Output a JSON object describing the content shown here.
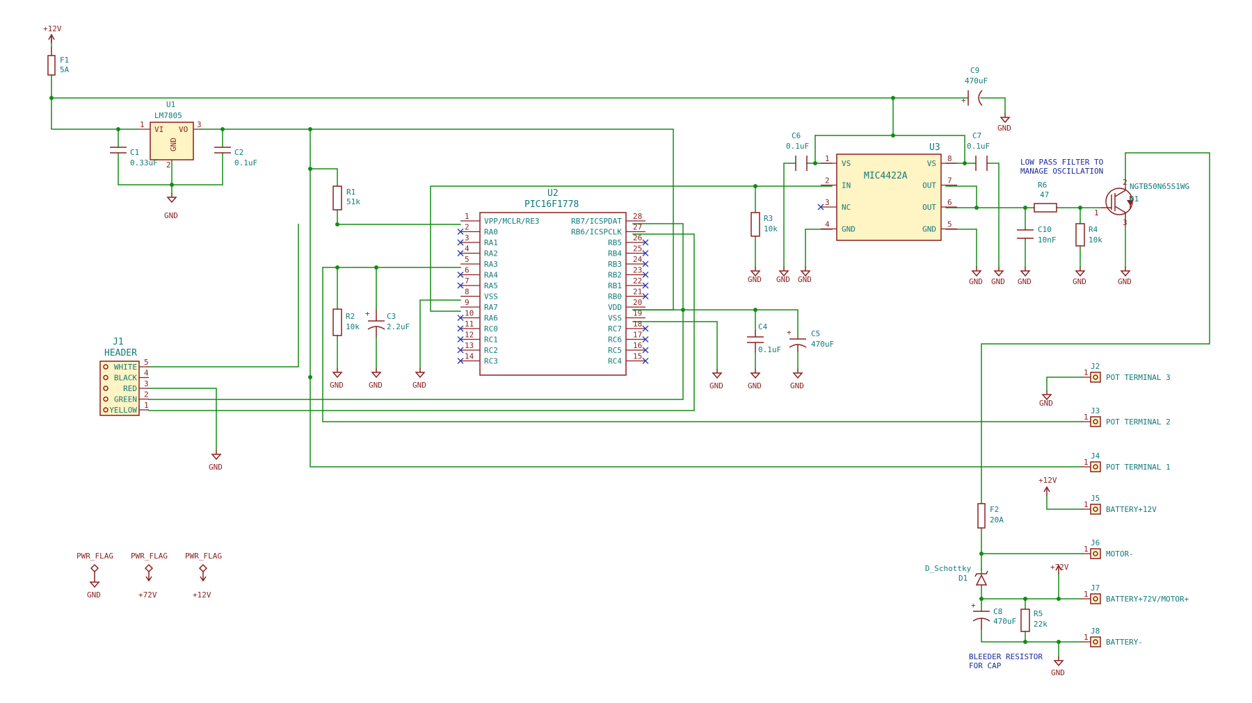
{
  "rails": {
    "v12": "+12V",
    "v72": "+72V",
    "gnd": "GND"
  },
  "pwr_flags": [
    {
      "label": "PWR_FLAG",
      "net": "GND"
    },
    {
      "label": "PWR_FLAG",
      "net": "+72V"
    },
    {
      "label": "PWR_FLAG",
      "net": "+12V"
    }
  ],
  "components": {
    "F1": {
      "ref": "F1",
      "value": "5A"
    },
    "F2": {
      "ref": "F2",
      "value": "20A"
    },
    "U1": {
      "ref": "U1",
      "value": "LM7805",
      "pin_vi": "VI",
      "pin_vo": "VO",
      "pin_gnd": "GND",
      "n1": "1",
      "n2": "2",
      "n3": "3"
    },
    "C1": {
      "ref": "C1",
      "value": "0.33uF"
    },
    "C2": {
      "ref": "C2",
      "value": "0.1uF"
    },
    "R1": {
      "ref": "R1",
      "value": "51k"
    },
    "R2": {
      "ref": "R2",
      "value": "10k"
    },
    "C3": {
      "ref": "C3",
      "value": "2.2uF"
    },
    "C4": {
      "ref": "C4",
      "value": "0.1uF"
    },
    "C5": {
      "ref": "C5",
      "value": "470uF"
    },
    "R3": {
      "ref": "R3",
      "value": "10k"
    },
    "C6": {
      "ref": "C6",
      "value": "0.1uF"
    },
    "C7": {
      "ref": "C7",
      "value": "0.1uF"
    },
    "C9": {
      "ref": "C9",
      "value": "470uF"
    },
    "R6": {
      "ref": "R6",
      "value": "47"
    },
    "C10": {
      "ref": "C10",
      "value": "10nF"
    },
    "R4": {
      "ref": "R4",
      "value": "10k"
    },
    "Q1": {
      "ref": "Q1",
      "value": "NGTB50N65S1WG"
    },
    "D1": {
      "ref": "D1",
      "value": "D_Schottky"
    },
    "C8": {
      "ref": "C8",
      "value": "470uF"
    },
    "R5": {
      "ref": "R5",
      "value": "22k"
    },
    "J1": {
      "ref": "J1",
      "value": "HEADER"
    }
  },
  "U2": {
    "ref": "U2",
    "value": "PIC16F1778",
    "left_pins": [
      {
        "n": "1",
        "name": "VPP/MCLR/RE3"
      },
      {
        "n": "2",
        "name": "RA0"
      },
      {
        "n": "3",
        "name": "RA1"
      },
      {
        "n": "4",
        "name": "RA2"
      },
      {
        "n": "5",
        "name": "RA3"
      },
      {
        "n": "6",
        "name": "RA4"
      },
      {
        "n": "7",
        "name": "RA5"
      },
      {
        "n": "8",
        "name": "VSS"
      },
      {
        "n": "9",
        "name": "RA7"
      },
      {
        "n": "10",
        "name": "RA6"
      },
      {
        "n": "11",
        "name": "RC0"
      },
      {
        "n": "12",
        "name": "RC1"
      },
      {
        "n": "13",
        "name": "RC2"
      },
      {
        "n": "14",
        "name": "RC3"
      }
    ],
    "right_pins": [
      {
        "n": "28",
        "name": "RB7/ICSPDAT"
      },
      {
        "n": "27",
        "name": "RB6/ICSPCLK"
      },
      {
        "n": "26",
        "name": "RB5"
      },
      {
        "n": "25",
        "name": "RB4"
      },
      {
        "n": "24",
        "name": "RB3"
      },
      {
        "n": "23",
        "name": "RB2"
      },
      {
        "n": "22",
        "name": "RB1"
      },
      {
        "n": "21",
        "name": "RB0"
      },
      {
        "n": "20",
        "name": "VDD"
      },
      {
        "n": "19",
        "name": "VSS"
      },
      {
        "n": "18",
        "name": "RC7"
      },
      {
        "n": "17",
        "name": "RC6"
      },
      {
        "n": "16",
        "name": "RC5"
      },
      {
        "n": "15",
        "name": "RC4"
      }
    ]
  },
  "U3": {
    "ref": "U3",
    "value": "MIC4422A",
    "left_pins": [
      {
        "n": "1",
        "name": "VS"
      },
      {
        "n": "2",
        "name": "IN"
      },
      {
        "n": "3",
        "name": "NC"
      },
      {
        "n": "4",
        "name": "GND"
      }
    ],
    "right_pins": [
      {
        "n": "8",
        "name": "VS"
      },
      {
        "n": "7",
        "name": "OUT"
      },
      {
        "n": "6",
        "name": "OUT"
      },
      {
        "n": "5",
        "name": "GND"
      }
    ]
  },
  "q1_pins": {
    "g": "1",
    "c": "2",
    "e": "3"
  },
  "header_pins": [
    {
      "n": "5",
      "name": "WHITE"
    },
    {
      "n": "4",
      "name": "BLACK"
    },
    {
      "n": "3",
      "name": "RED"
    },
    {
      "n": "2",
      "name": "GREEN"
    },
    {
      "n": "1",
      "name": "YELLOW"
    }
  ],
  "connectors": [
    {
      "ref": "J2",
      "pin": "1",
      "label": "POT TERMINAL 3"
    },
    {
      "ref": "J3",
      "pin": "1",
      "label": "POT TERMINAL 2"
    },
    {
      "ref": "J4",
      "pin": "1",
      "label": "POT TERMINAL 1"
    },
    {
      "ref": "J5",
      "pin": "1",
      "label": "BATTERY+12V"
    },
    {
      "ref": "J6",
      "pin": "1",
      "label": "MOTOR-"
    },
    {
      "ref": "J7",
      "pin": "1",
      "label": "BATTERY+72V/MOTOR+"
    },
    {
      "ref": "J8",
      "pin": "1",
      "label": "BATTERY-"
    }
  ],
  "notes": {
    "lpf_1": "LOW PASS FILTER TO",
    "lpf_2": "MANAGE OSCILLATION",
    "bleed_1": "BLEEDER RESISTOR",
    "bleed_2": "FOR CAP"
  }
}
